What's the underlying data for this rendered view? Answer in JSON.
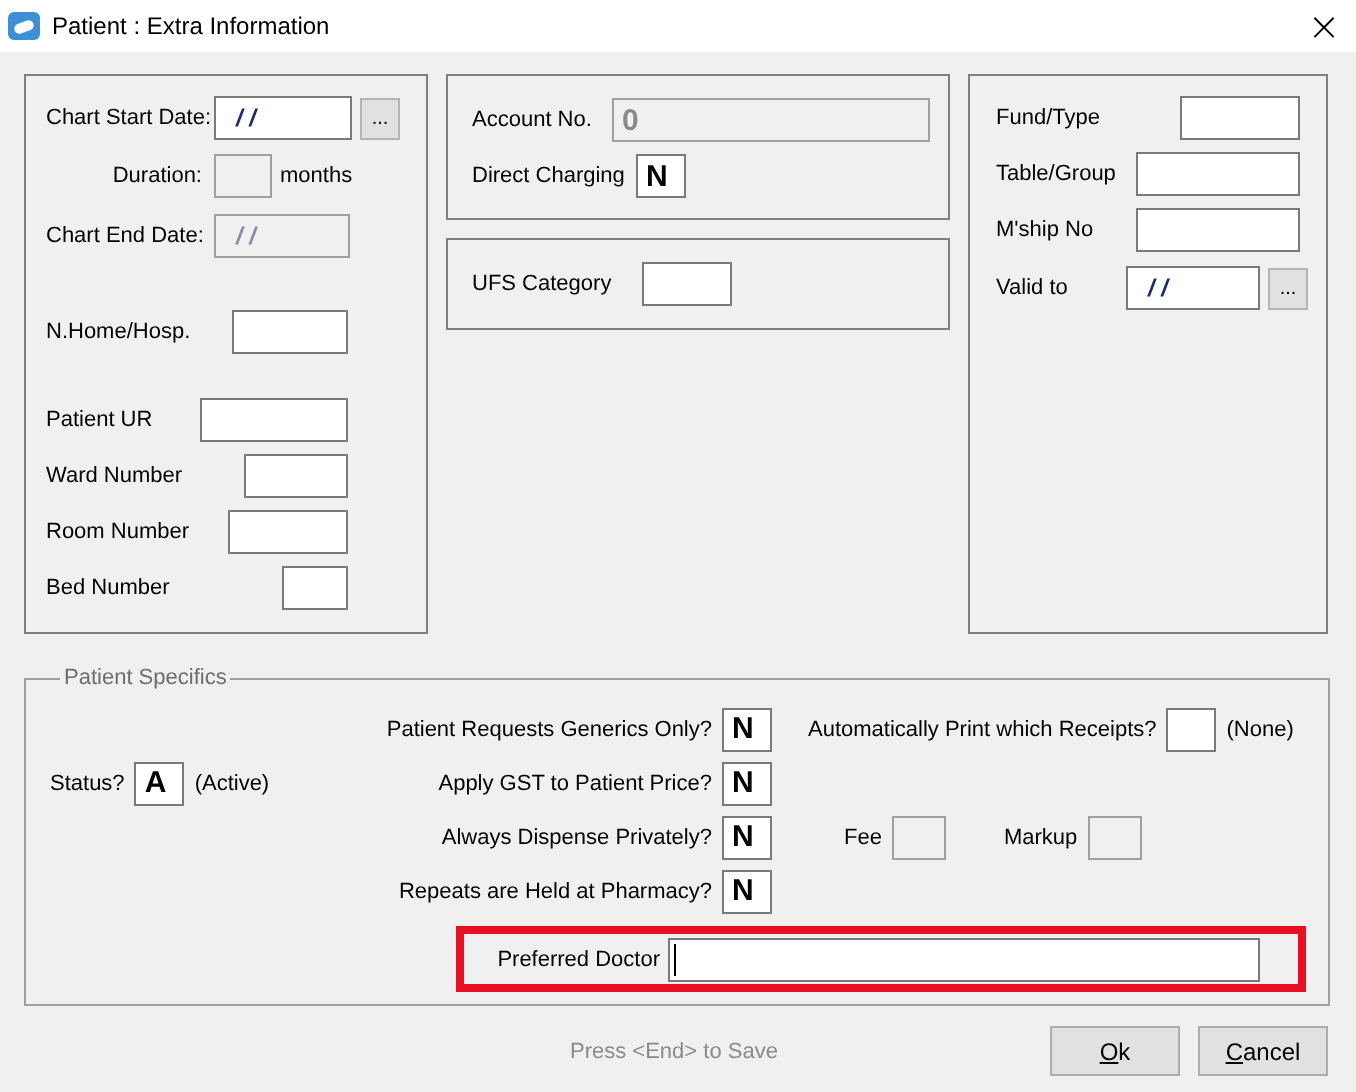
{
  "window": {
    "title": "Patient : Extra Information",
    "close": "×"
  },
  "chart_panel": {
    "fields": [
      {
        "label": "Chart Start Date:",
        "kind": "date",
        "value": "/ /",
        "disabled": false,
        "picker": "..."
      },
      {
        "label": "Duration:",
        "kind": "text",
        "disabled": true,
        "suffix": "months"
      },
      {
        "label": "Chart End Date:",
        "kind": "date",
        "value": "/ /",
        "disabled": true
      },
      {
        "label": "N.Home/Hosp.",
        "kind": "text",
        "disabled": false
      },
      {
        "label": "Patient UR",
        "kind": "text",
        "disabled": false
      },
      {
        "label": "Ward Number",
        "kind": "text",
        "disabled": false
      },
      {
        "label": "Room Number",
        "kind": "text",
        "disabled": false
      },
      {
        "label": "Bed Number",
        "kind": "text",
        "disabled": false
      }
    ]
  },
  "account_panel": {
    "fields": [
      {
        "label": "Account No.",
        "kind": "code",
        "value": "0",
        "disabled": true
      },
      {
        "label": "Direct Charging",
        "kind": "code",
        "value": "N",
        "disabled": false
      }
    ]
  },
  "ufs_panel": {
    "fields": [
      {
        "label": "UFS Category",
        "kind": "text",
        "disabled": false
      }
    ]
  },
  "fund_panel": {
    "fields": [
      {
        "label": "Fund/Type",
        "kind": "text",
        "disabled": false
      },
      {
        "label": "Table/Group",
        "kind": "text",
        "disabled": false
      },
      {
        "label": "M'ship No",
        "kind": "text",
        "disabled": false
      },
      {
        "label": "Valid to",
        "kind": "date",
        "value": "/ /",
        "disabled": false,
        "picker": "..."
      }
    ]
  },
  "patient_specifics": {
    "legend": "Patient Specifics",
    "status": {
      "label": "Status?",
      "value": "A",
      "note": "(Active)"
    },
    "questions": [
      {
        "label": "Patient Requests Generics Only?",
        "value": "N"
      },
      {
        "label": "Apply GST to Patient Price?",
        "value": "N"
      },
      {
        "label": "Always Dispense Privately?",
        "value": "N"
      },
      {
        "label": "Repeats are Held at Pharmacy?",
        "value": "N"
      }
    ],
    "receipts": {
      "label": "Automatically Print which Receipts?",
      "note": "(None)"
    },
    "fee": {
      "label": "Fee",
      "disabled": true
    },
    "markup": {
      "label": "Markup",
      "disabled": true
    },
    "preferred_doctor": {
      "label": "Preferred Doctor",
      "focused": true,
      "highlighted": true
    }
  },
  "footer": {
    "hint": "Press <End> to Save",
    "buttons": [
      {
        "label": "Ok"
      },
      {
        "label": "Cancel"
      }
    ]
  }
}
